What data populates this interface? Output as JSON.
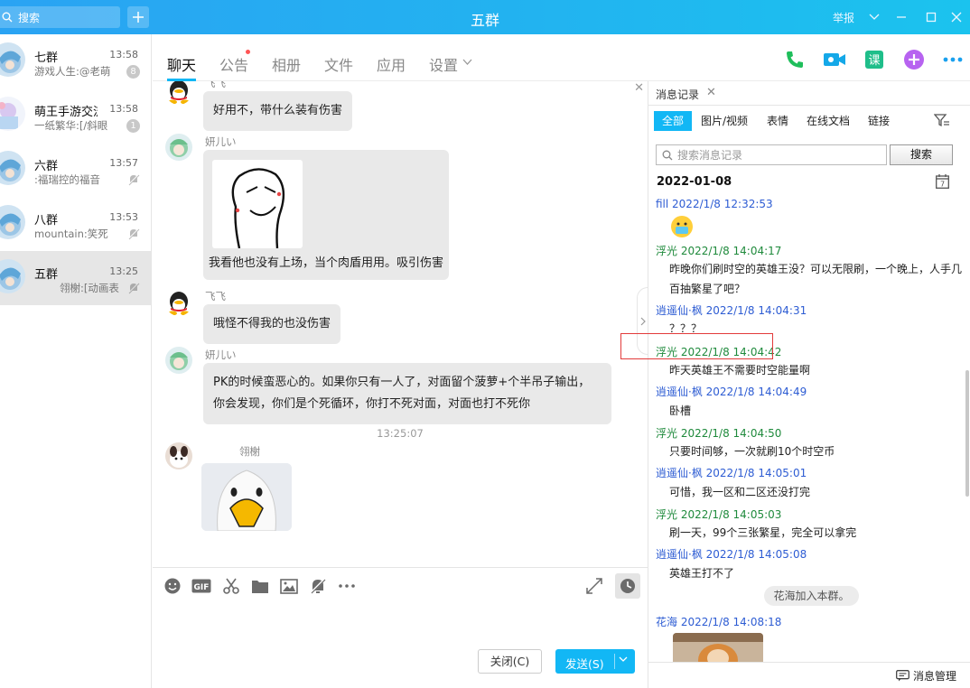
{
  "window": {
    "title": "五群",
    "report_label": "举报"
  },
  "search": {
    "placeholder": "搜索"
  },
  "sidebar": {
    "conversations": [
      {
        "name": "七群",
        "time": "13:58",
        "preview": "游戏人生:@老萌",
        "badge": "8"
      },
      {
        "name": "萌王手游交流",
        "time": "13:58",
        "preview": "一纸繁华:[/斜眼",
        "badge": "1"
      },
      {
        "name": "六群",
        "time": "13:57",
        "preview": ":福瑞控的福音",
        "badge": ""
      },
      {
        "name": "八群",
        "time": "13:53",
        "preview": "mountain:笑死",
        "badge": ""
      },
      {
        "name": "五群",
        "time": "13:25",
        "preview": "翎榭:[动画表",
        "badge": ""
      }
    ]
  },
  "tabs": {
    "items": [
      "聊天",
      "公告",
      "相册",
      "文件",
      "应用",
      "设置"
    ]
  },
  "chat": {
    "partial_sender": "飞飞",
    "messages": [
      {
        "sender": "",
        "text": "好用不，带什么装有伤害"
      },
      {
        "sender": "妍儿い",
        "text": "我看他也没有上场，当个肉盾用用。吸引伤害"
      },
      {
        "sender": "飞飞",
        "text": "哦怪不得我的也没伤害"
      },
      {
        "sender": "妍儿い",
        "text": "PK的时候蛮恶心的。如果你只有一人了，对面留个菠萝+个半吊子输出，你会发现，你们是个死循环，你打不死对面，对面也打不死你"
      }
    ],
    "timestamp": "13:25:07",
    "last_sender": "翎榭"
  },
  "send_area": {
    "close_label": "关闭(C)",
    "send_label": "发送(S)"
  },
  "history": {
    "tab_label": "消息记录",
    "filters": [
      "全部",
      "图片/视频",
      "表情",
      "在线文档",
      "链接"
    ],
    "search_placeholder": "搜索消息记录",
    "search_button": "搜索",
    "date": "2022-01-08",
    "records": [
      {
        "head": "fill 2022/1/8 12:32:53",
        "body": ""
      },
      {
        "head": "浮光 2022/1/8 14:04:17",
        "body": "昨晚你们刷时空的英雄王没？可以无限刷，一个晚上，人手几百抽繁星了吧？"
      },
      {
        "head": "逍遥仙·枫 2022/1/8 14:04:31",
        "body": "？？？"
      },
      {
        "head": "浮光 2022/1/8 14:04:42",
        "body": "昨天英雄王不需要时空能量啊"
      },
      {
        "head": "逍遥仙·枫 2022/1/8 14:04:49",
        "body": "卧槽"
      },
      {
        "head": "浮光 2022/1/8 14:04:50",
        "body": "只要时间够，一次就刷10个时空币"
      },
      {
        "head": "逍遥仙·枫 2022/1/8 14:05:01",
        "body": "可惜，我一区和二区还没打完"
      },
      {
        "head": "浮光 2022/1/8 14:05:03",
        "body": "刷一天，99个三张繁星，完全可以拿完"
      },
      {
        "head": "逍遥仙·枫 2022/1/8 14:05:08",
        "body": "英雄王打不了"
      },
      {
        "head": "花海 2022/1/8 14:08:18",
        "body": ""
      }
    ],
    "system_notice": "花海加入本群。",
    "manage_label": "消息管理"
  },
  "colors": {
    "titlebar": "#22b3f0",
    "accent": "#12b7f5",
    "record_blue": "#2d5cd3",
    "record_green": "#1f8a3c"
  }
}
